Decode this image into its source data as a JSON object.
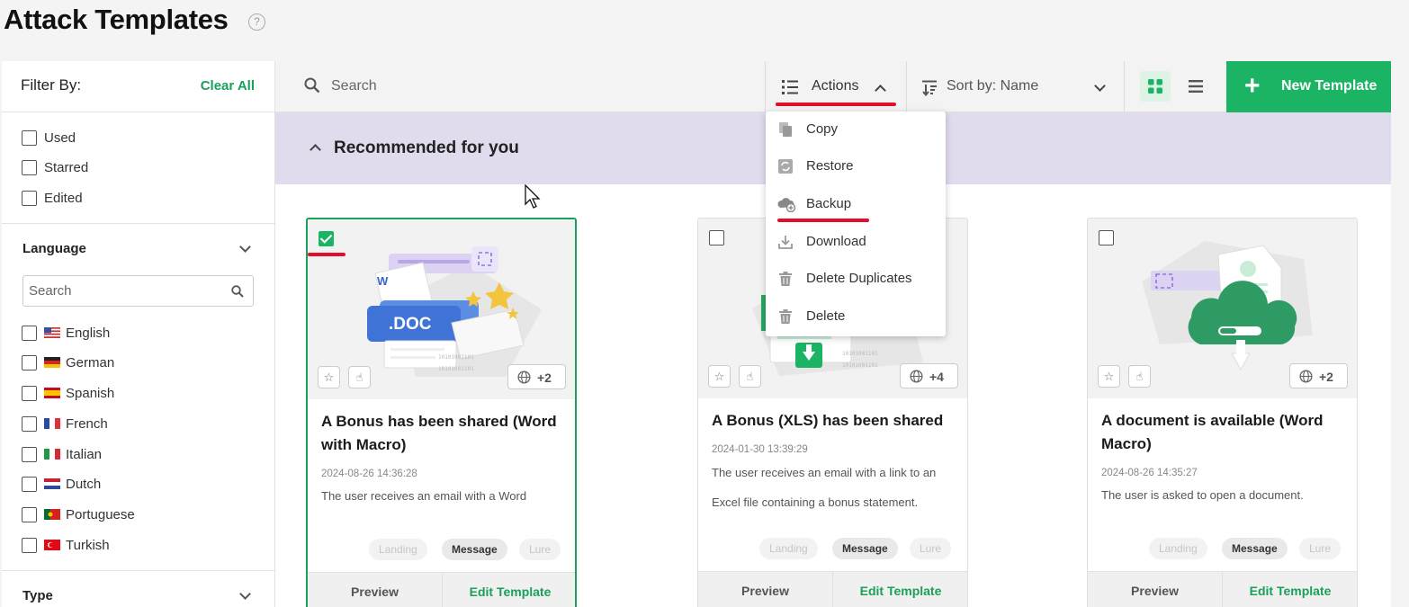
{
  "header": {
    "title": "Attack Templates",
    "help": "?"
  },
  "sidebar": {
    "filter_title": "Filter By:",
    "clear_all": "Clear All",
    "status_filters": [
      "Used",
      "Starred",
      "Edited"
    ],
    "language_title": "Language",
    "language_search_placeholder": "Search",
    "languages": [
      "English",
      "German",
      "Spanish",
      "French",
      "Italian",
      "Dutch",
      "Portuguese",
      "Turkish"
    ],
    "type_title": "Type"
  },
  "toolbar": {
    "search_placeholder": "Search",
    "actions_label": "Actions",
    "sort_label": "Sort by: Name",
    "new_template_label": "New Template"
  },
  "actions_menu": [
    "Copy",
    "Restore",
    "Backup",
    "Download",
    "Delete Duplicates",
    "Delete"
  ],
  "section": {
    "title": "Recommended for you"
  },
  "cards": [
    {
      "title": "A Bonus has been shared (Word with Macro)",
      "date": "2024-08-26 14:36:28",
      "description": "The user receives an email with a Word",
      "languages_badge": "+2",
      "selected": true,
      "tags": [
        "Landing",
        "Message",
        "Lure"
      ],
      "preview": "Preview",
      "edit": "Edit Template",
      "image_text": ".DOC"
    },
    {
      "title": "A Bonus (XLS) has been shared",
      "date": "2024-01-30 13:39:29",
      "description": "The user receives an email with a link to an Excel file containing a bonus statement.",
      "languages_badge": "+4",
      "selected": false,
      "tags": [
        "Landing",
        "Message",
        "Lure"
      ],
      "preview": "Preview",
      "edit": "Edit Template"
    },
    {
      "title": "A document is available (Word Macro)",
      "date": "2024-08-26 14:35:27",
      "description": "The user is asked to open a document.",
      "languages_badge": "+2",
      "selected": false,
      "tags": [
        "Landing",
        "Message",
        "Lure"
      ],
      "preview": "Preview",
      "edit": "Edit Template"
    }
  ],
  "colors": {
    "accent": "#1bb364",
    "recommended_bg": "#e1dbee",
    "annotation_red": "#e0102a"
  }
}
